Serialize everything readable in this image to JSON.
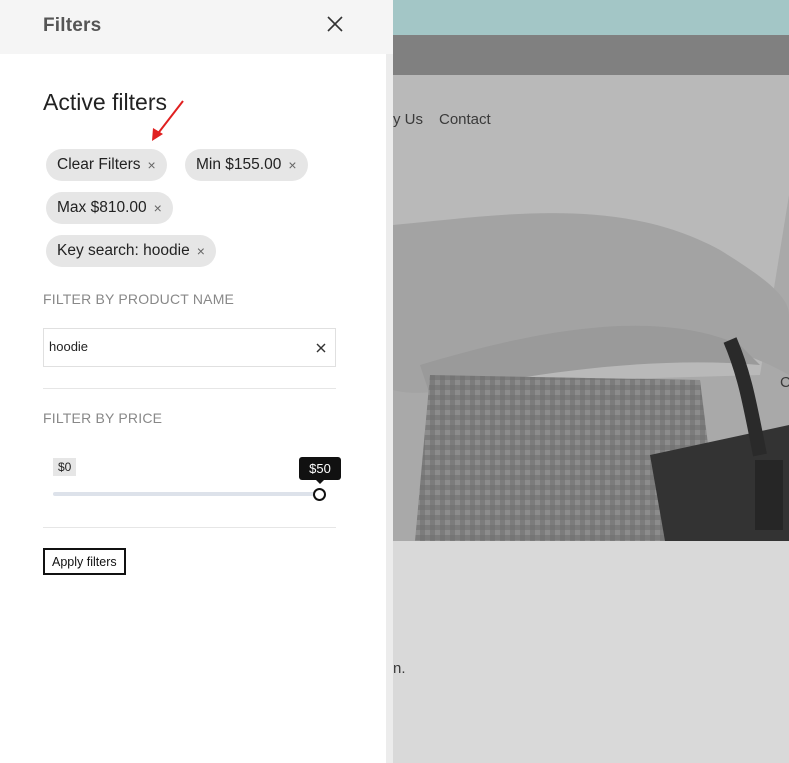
{
  "drawer": {
    "title": "Filters",
    "active_filters_title": "Active filters",
    "chips": [
      {
        "label": "Clear Filters",
        "remove": "×"
      },
      {
        "label": "Min $155.00",
        "remove": "×"
      },
      {
        "label": "Max $810.00",
        "remove": "×"
      },
      {
        "label": "Key search: hoodie",
        "remove": "×"
      }
    ],
    "filter_by_name": {
      "label": "FILTER BY PRODUCT NAME",
      "value": "hoodie"
    },
    "filter_by_price": {
      "label": "FILTER BY PRICE",
      "min_label": "$0",
      "current_label": "$50",
      "slider_position": 1.0
    },
    "apply_label": "Apply filters"
  },
  "background": {
    "nav_links": [
      "y Us",
      "Contact"
    ],
    "side_fragment": "C",
    "body_fragment": "n."
  },
  "colors": {
    "topbar": "#a3c6c6",
    "navbar": "#808080",
    "overlay": "#d9d9d9",
    "chip_bg": "#e6e6e6",
    "annotation_arrow": "#e02020"
  },
  "icons": [
    "close-icon",
    "remove-x-icon",
    "clear-input-icon",
    "annotation-arrow-icon",
    "slider-handle-icon"
  ]
}
